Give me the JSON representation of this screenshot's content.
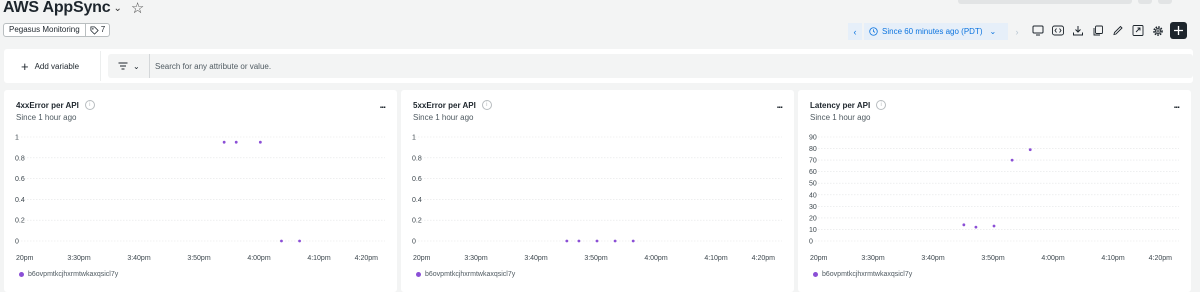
{
  "header": {
    "title": "AWS AppSync",
    "dashboard_name": "Pegasus Monitoring",
    "tag_count": "7"
  },
  "time_picker": {
    "label": "Since 60 minutes ago (PDT)"
  },
  "toolbar": {
    "icons": [
      "tv-mode-icon",
      "code-icon",
      "download-icon",
      "copy-icon",
      "edit-icon",
      "fullscreen-icon",
      "settings-icon",
      "add-icon"
    ]
  },
  "variables": {
    "add_label": "Add variable",
    "search_placeholder": "Search for any attribute or value."
  },
  "colors": {
    "accent": "#0c74df",
    "series": "#8b4fd6"
  },
  "widgets": [
    {
      "title": "4xxError per API",
      "subtitle": "Since 1 hour ago",
      "more_label": "...",
      "legend": "b6ovpmtkcjhxrmtwkaxqsicl7y"
    },
    {
      "title": "5xxError per API",
      "subtitle": "Since 1 hour ago",
      "more_label": "...",
      "legend": "b6ovpmtkcjhxrmtwkaxqsicl7y"
    },
    {
      "title": "Latency per API",
      "subtitle": "Since 1 hour ago",
      "more_label": "...",
      "legend": "b6ovpmtkcjhxrmtwkaxqsicl7y"
    }
  ],
  "chart_data": [
    {
      "type": "scatter",
      "title": "4xxError per API",
      "x_ticks": [
        "20pm",
        "3:30pm",
        "3:40pm",
        "3:50pm",
        "4:00pm",
        "4:10pm",
        "4:20pm"
      ],
      "y_ticks": [
        "1",
        "0.8",
        "0.6",
        "0.4",
        "0.2",
        "0"
      ],
      "ylim": [
        0,
        1
      ],
      "grid": true,
      "series": [
        {
          "name": "b6ovpmtkcjhxrmtwkaxqsicl7y",
          "points": [
            [
              3.45,
              0.95
            ],
            [
              3.65,
              0.95
            ],
            [
              4.05,
              0.95
            ],
            [
              4.4,
              0
            ],
            [
              4.7,
              0
            ]
          ]
        }
      ]
    },
    {
      "type": "scatter",
      "title": "5xxError per API",
      "x_ticks": [
        "20pm",
        "3:30pm",
        "3:40pm",
        "3:50pm",
        "4:00pm",
        "4:10pm",
        "4:20pm"
      ],
      "y_ticks": [
        "1",
        "0.8",
        "0.6",
        "0.4",
        "0.2",
        "0"
      ],
      "ylim": [
        0,
        1
      ],
      "grid": true,
      "series": [
        {
          "name": "b6ovpmtkcjhxrmtwkaxqsicl7y",
          "points": [
            [
              2.55,
              0
            ],
            [
              2.75,
              0
            ],
            [
              3.05,
              0
            ],
            [
              3.35,
              0
            ],
            [
              3.65,
              0
            ]
          ]
        }
      ]
    },
    {
      "type": "scatter",
      "title": "Latency per API",
      "x_ticks": [
        "20pm",
        "3:30pm",
        "3:40pm",
        "3:50pm",
        "4:00pm",
        "4:10pm",
        "4:20pm"
      ],
      "y_ticks": [
        "90",
        "80",
        "70",
        "60",
        "50",
        "40",
        "30",
        "20",
        "10",
        "0"
      ],
      "ylim": [
        0,
        90
      ],
      "grid": true,
      "series": [
        {
          "name": "b6ovpmtkcjhxrmtwkaxqsicl7y",
          "points": [
            [
              2.55,
              14
            ],
            [
              2.75,
              12
            ],
            [
              3.05,
              13
            ],
            [
              3.35,
              70
            ],
            [
              3.65,
              79
            ]
          ]
        }
      ]
    }
  ]
}
